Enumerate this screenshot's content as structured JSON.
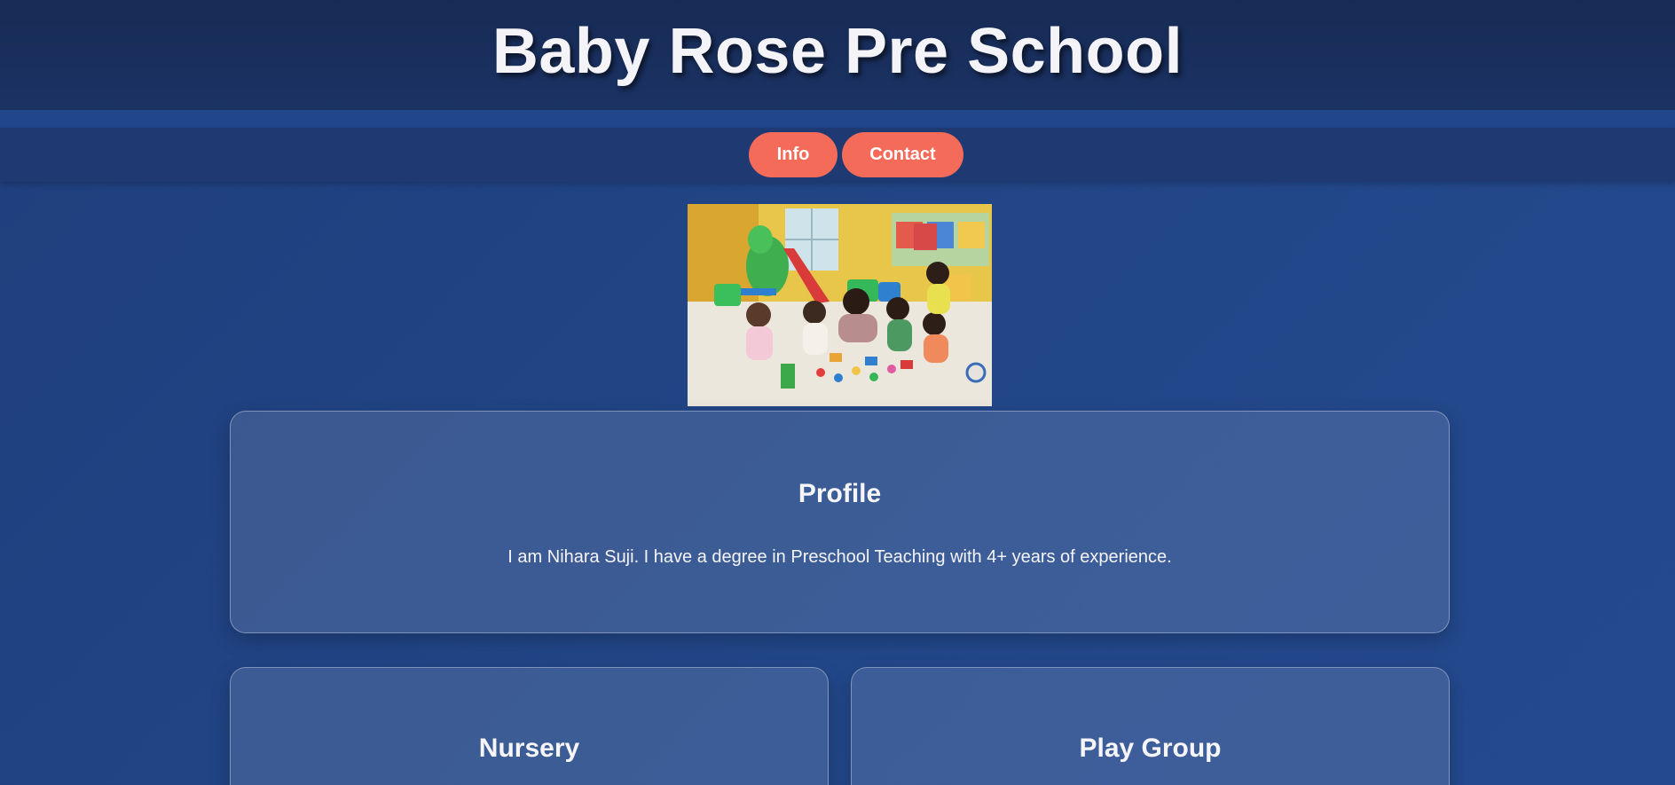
{
  "header": {
    "title": "Baby Rose Pre School"
  },
  "nav": {
    "info_label": "Info",
    "contact_label": "Contact"
  },
  "hero": {
    "image": "classroom-children-playing-image"
  },
  "profile": {
    "heading": "Profile",
    "text": "I am Nihara Suji. I have a degree in Preschool Teaching with 4+ years of experience."
  },
  "programs": {
    "nursery": "Nursery",
    "play_group": "Play Group"
  },
  "colors": {
    "background": "#224789",
    "header": "#172b55",
    "nav_bar": "#1f3a73",
    "button": "#f46b5a"
  }
}
